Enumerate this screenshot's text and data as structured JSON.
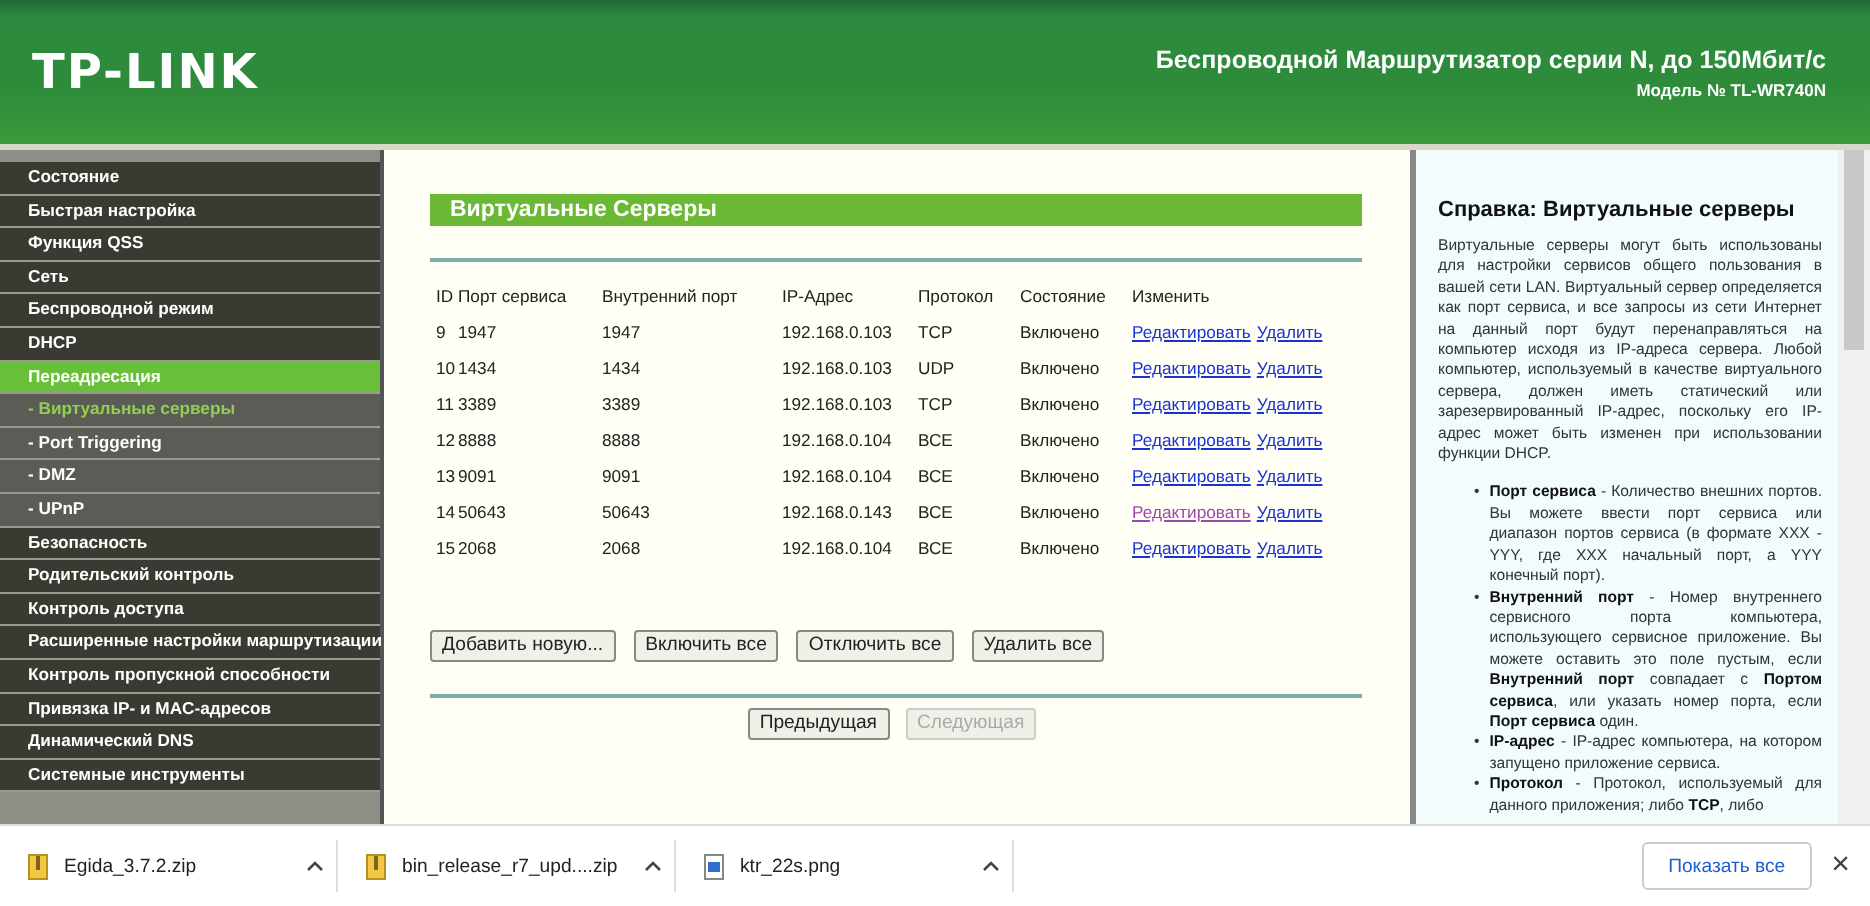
{
  "header": {
    "logo": "TP-LINK",
    "title": "Беспроводной Маршрутизатор серии N, до 150Мбит/с",
    "model": "Модель № TL-WR740N"
  },
  "sidebar": {
    "items": [
      {
        "label": "Состояние",
        "selected": false
      },
      {
        "label": "Быстрая настройка",
        "selected": false
      },
      {
        "label": "Функция QSS",
        "selected": false
      },
      {
        "label": "Сеть",
        "selected": false
      },
      {
        "label": "Беспроводной режим",
        "selected": false
      },
      {
        "label": "DHCP",
        "selected": false
      },
      {
        "label": "Переадресация",
        "selected": true,
        "children": [
          {
            "label": "- Виртуальные серверы",
            "selected": true
          },
          {
            "label": "- Port Triggering",
            "selected": false
          },
          {
            "label": "- DMZ",
            "selected": false
          },
          {
            "label": "- UPnP",
            "selected": false
          }
        ]
      },
      {
        "label": "Безопасность",
        "selected": false
      },
      {
        "label": "Родительский контроль",
        "selected": false
      },
      {
        "label": "Контроль доступа",
        "selected": false
      },
      {
        "label": "Расширенные настройки маршрутизации",
        "selected": false
      },
      {
        "label": "Контроль пропускной способности",
        "selected": false
      },
      {
        "label": "Привязка IP- и MAC-адресов",
        "selected": false
      },
      {
        "label": "Динамический DNS",
        "selected": false
      },
      {
        "label": "Системные инструменты",
        "selected": false
      }
    ]
  },
  "main": {
    "title": "Виртуальные Серверы",
    "table": {
      "columns": [
        "ID",
        "Порт сервиса",
        "Внутренний порт",
        "IP-Адрес",
        "Протокол",
        "Состояние",
        "Изменить"
      ],
      "rows": [
        {
          "id": "9",
          "service_port": "1947",
          "internal_port": "1947",
          "ip": "192.168.0.103",
          "protocol": "TCP",
          "status": "Включено",
          "edit": "Редактировать",
          "delete": "Удалить",
          "edit_visited": false
        },
        {
          "id": "10",
          "service_port": "1434",
          "internal_port": "1434",
          "ip": "192.168.0.103",
          "protocol": "UDP",
          "status": "Включено",
          "edit": "Редактировать",
          "delete": "Удалить",
          "edit_visited": false
        },
        {
          "id": "11",
          "service_port": "3389",
          "internal_port": "3389",
          "ip": "192.168.0.103",
          "protocol": "TCP",
          "status": "Включено",
          "edit": "Редактировать",
          "delete": "Удалить",
          "edit_visited": false
        },
        {
          "id": "12",
          "service_port": "8888",
          "internal_port": "8888",
          "ip": "192.168.0.104",
          "protocol": "ВСЕ",
          "status": "Включено",
          "edit": "Редактировать",
          "delete": "Удалить",
          "edit_visited": false
        },
        {
          "id": "13",
          "service_port": "9091",
          "internal_port": "9091",
          "ip": "192.168.0.104",
          "protocol": "ВСЕ",
          "status": "Включено",
          "edit": "Редактировать",
          "delete": "Удалить",
          "edit_visited": false
        },
        {
          "id": "14",
          "service_port": "50643",
          "internal_port": "50643",
          "ip": "192.168.0.143",
          "protocol": "ВСЕ",
          "status": "Включено",
          "edit": "Редактировать",
          "delete": "Удалить",
          "edit_visited": true
        },
        {
          "id": "15",
          "service_port": "2068",
          "internal_port": "2068",
          "ip": "192.168.0.104",
          "protocol": "ВСЕ",
          "status": "Включено",
          "edit": "Редактировать",
          "delete": "Удалить",
          "edit_visited": false
        }
      ]
    },
    "actions": [
      "Добавить новую...",
      "Включить все",
      "Отключить все",
      "Удалить все"
    ],
    "pager": [
      {
        "label": "Предыдущая",
        "disabled": false
      },
      {
        "label": "Следующая",
        "disabled": true
      }
    ]
  },
  "help": {
    "title": "Справка: Виртуальные серверы",
    "intro": "Виртуальные серверы могут быть использованы для настройки сервисов общего пользования в вашей сети LAN. Виртуальный сервер определяется как порт сервиса, и все запросы из сети Интернет на данный порт будут перенаправляться на компьютер исходя из IP-адреса сервера. Любой компьютер, используемый в качестве виртуального сервера, должен иметь статический или зарезервированный IP-адрес, поскольку его IP-адрес может быть изменен при использовании функции DHCP.",
    "items": [
      {
        "bullet": "•",
        "text": "**Порт сервиса** - Количество внешних портов. Вы можете ввести порт сервиса или диапазон портов сервиса (в формате XXX - YYY, где XXX начальный порт, а YYY конечный порт)."
      },
      {
        "bullet": "•",
        "text": "**Внутренний порт** - Номер внутреннего сервисного порта компьютера, использующего сервисное приложение. Вы можете оставить это поле пустым, если **Внутренний порт** совпадает с **Портом сервиса**, или указать номер порта, если **Порт сервиса** один."
      },
      {
        "bullet": "•",
        "text": "**IP-адрес** - IP-адрес компьютера, на котором запущено приложение сервиса."
      },
      {
        "bullet": "•",
        "text": "**Протокол** - Протокол, используемый для данного приложения; либо **TCP**, либо"
      }
    ]
  },
  "downloads": {
    "items": [
      {
        "name": "Egida_3.7.2.zip",
        "kind": "zip"
      },
      {
        "name": "bin_release_r7_upd....zip",
        "kind": "zip"
      },
      {
        "name": "ktr_22s.png",
        "kind": "image"
      }
    ],
    "show_all": "Показать все",
    "close": "×"
  }
}
